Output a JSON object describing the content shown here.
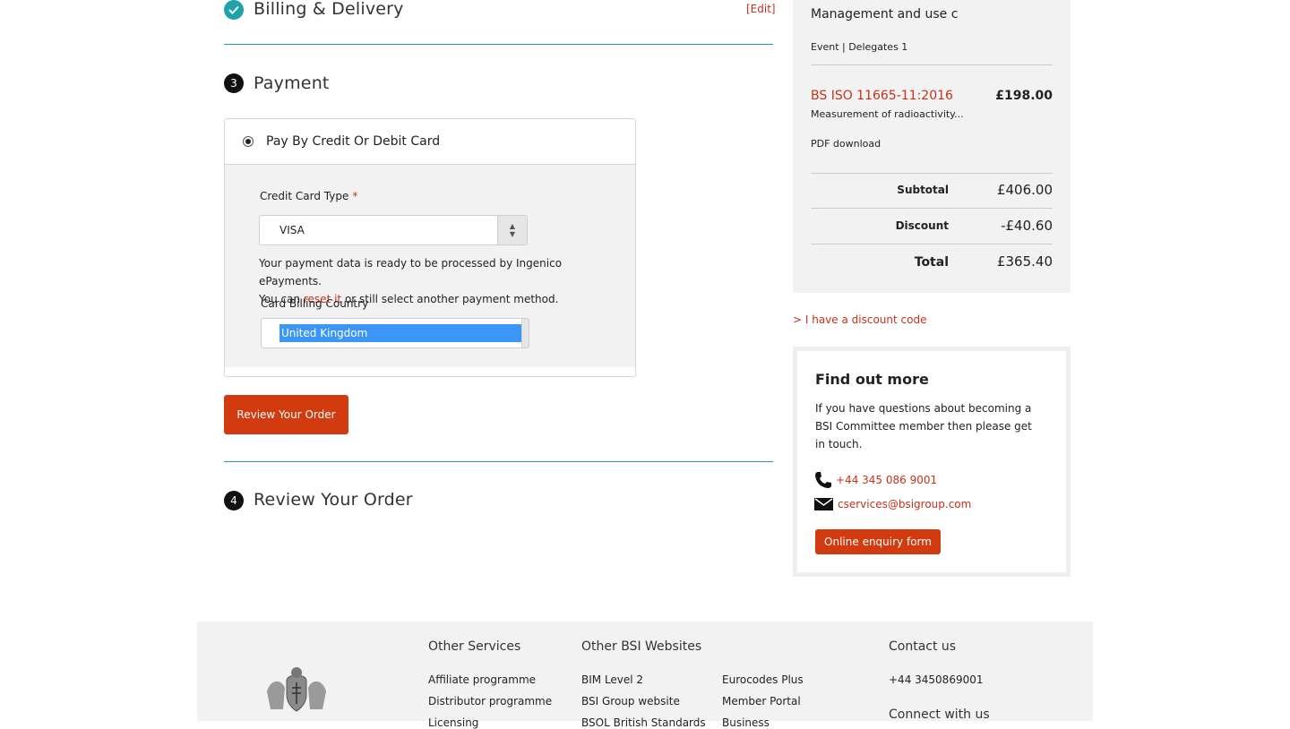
{
  "steps": {
    "billing": {
      "title": "Billing & Delivery",
      "edit": "[Edit]"
    },
    "payment": {
      "number": "3",
      "title": "Payment"
    },
    "review": {
      "number": "4",
      "title": "Review Your Order"
    }
  },
  "payment": {
    "method_label": "Pay By Credit Or Debit Card",
    "card_type_label": "Credit Card Type",
    "required_mark": "*",
    "card_type_value": "VISA",
    "note_line1": "Your payment data is ready to be processed by Ingenico ePayments.",
    "note_line2_pre": "You can ",
    "note_line2_link": "reset it",
    "note_line2_post": " or still select another payment method.",
    "billing_country_label": "Card Billing Country",
    "billing_country_value": "United Kingdom",
    "review_button": "Review Your Order"
  },
  "summary": {
    "item1": {
      "name": "Management and use c",
      "meta": "Event | Delegates 1"
    },
    "item2": {
      "name": "BS ISO 11665-11:2016",
      "desc": "Measurement of radioactivity...",
      "meta": "PDF download",
      "price": "£198.00"
    },
    "subtotal_label": "Subtotal",
    "subtotal_value": "£406.00",
    "discount_label": "Discount",
    "discount_value": "-£40.60",
    "total_label": "Total",
    "total_value": "£365.40"
  },
  "discount_code_link": "> I have a discount code",
  "find_out_more": {
    "title": "Find out more",
    "text_line1": "If you have questions about becoming a",
    "text_line2": "BSI Committee member then please get",
    "text_line3": "in touch.",
    "phone": "+44 345 086 9001",
    "email": "cservices@bsigroup.com",
    "button": "Online enquiry form"
  },
  "footer": {
    "other_services": {
      "heading": "Other Services",
      "items": [
        "Affiliate programme",
        "Distributor programme",
        "Licensing"
      ]
    },
    "other_websites": {
      "heading": "Other BSI Websites",
      "col1": [
        "BIM Level 2",
        "BSI Group website",
        "BSOL British Standards"
      ],
      "col2": [
        "Eurocodes Plus",
        "Member Portal",
        "Business"
      ]
    },
    "contact": {
      "heading": "Contact us",
      "phone": "+44 3450869001",
      "connect": "Connect with us"
    }
  },
  "colors": {
    "accent_red": "#d23a10",
    "link_red": "#c8311a",
    "teal": "#1fa2a8",
    "panel_grey": "#f2f2f2"
  }
}
